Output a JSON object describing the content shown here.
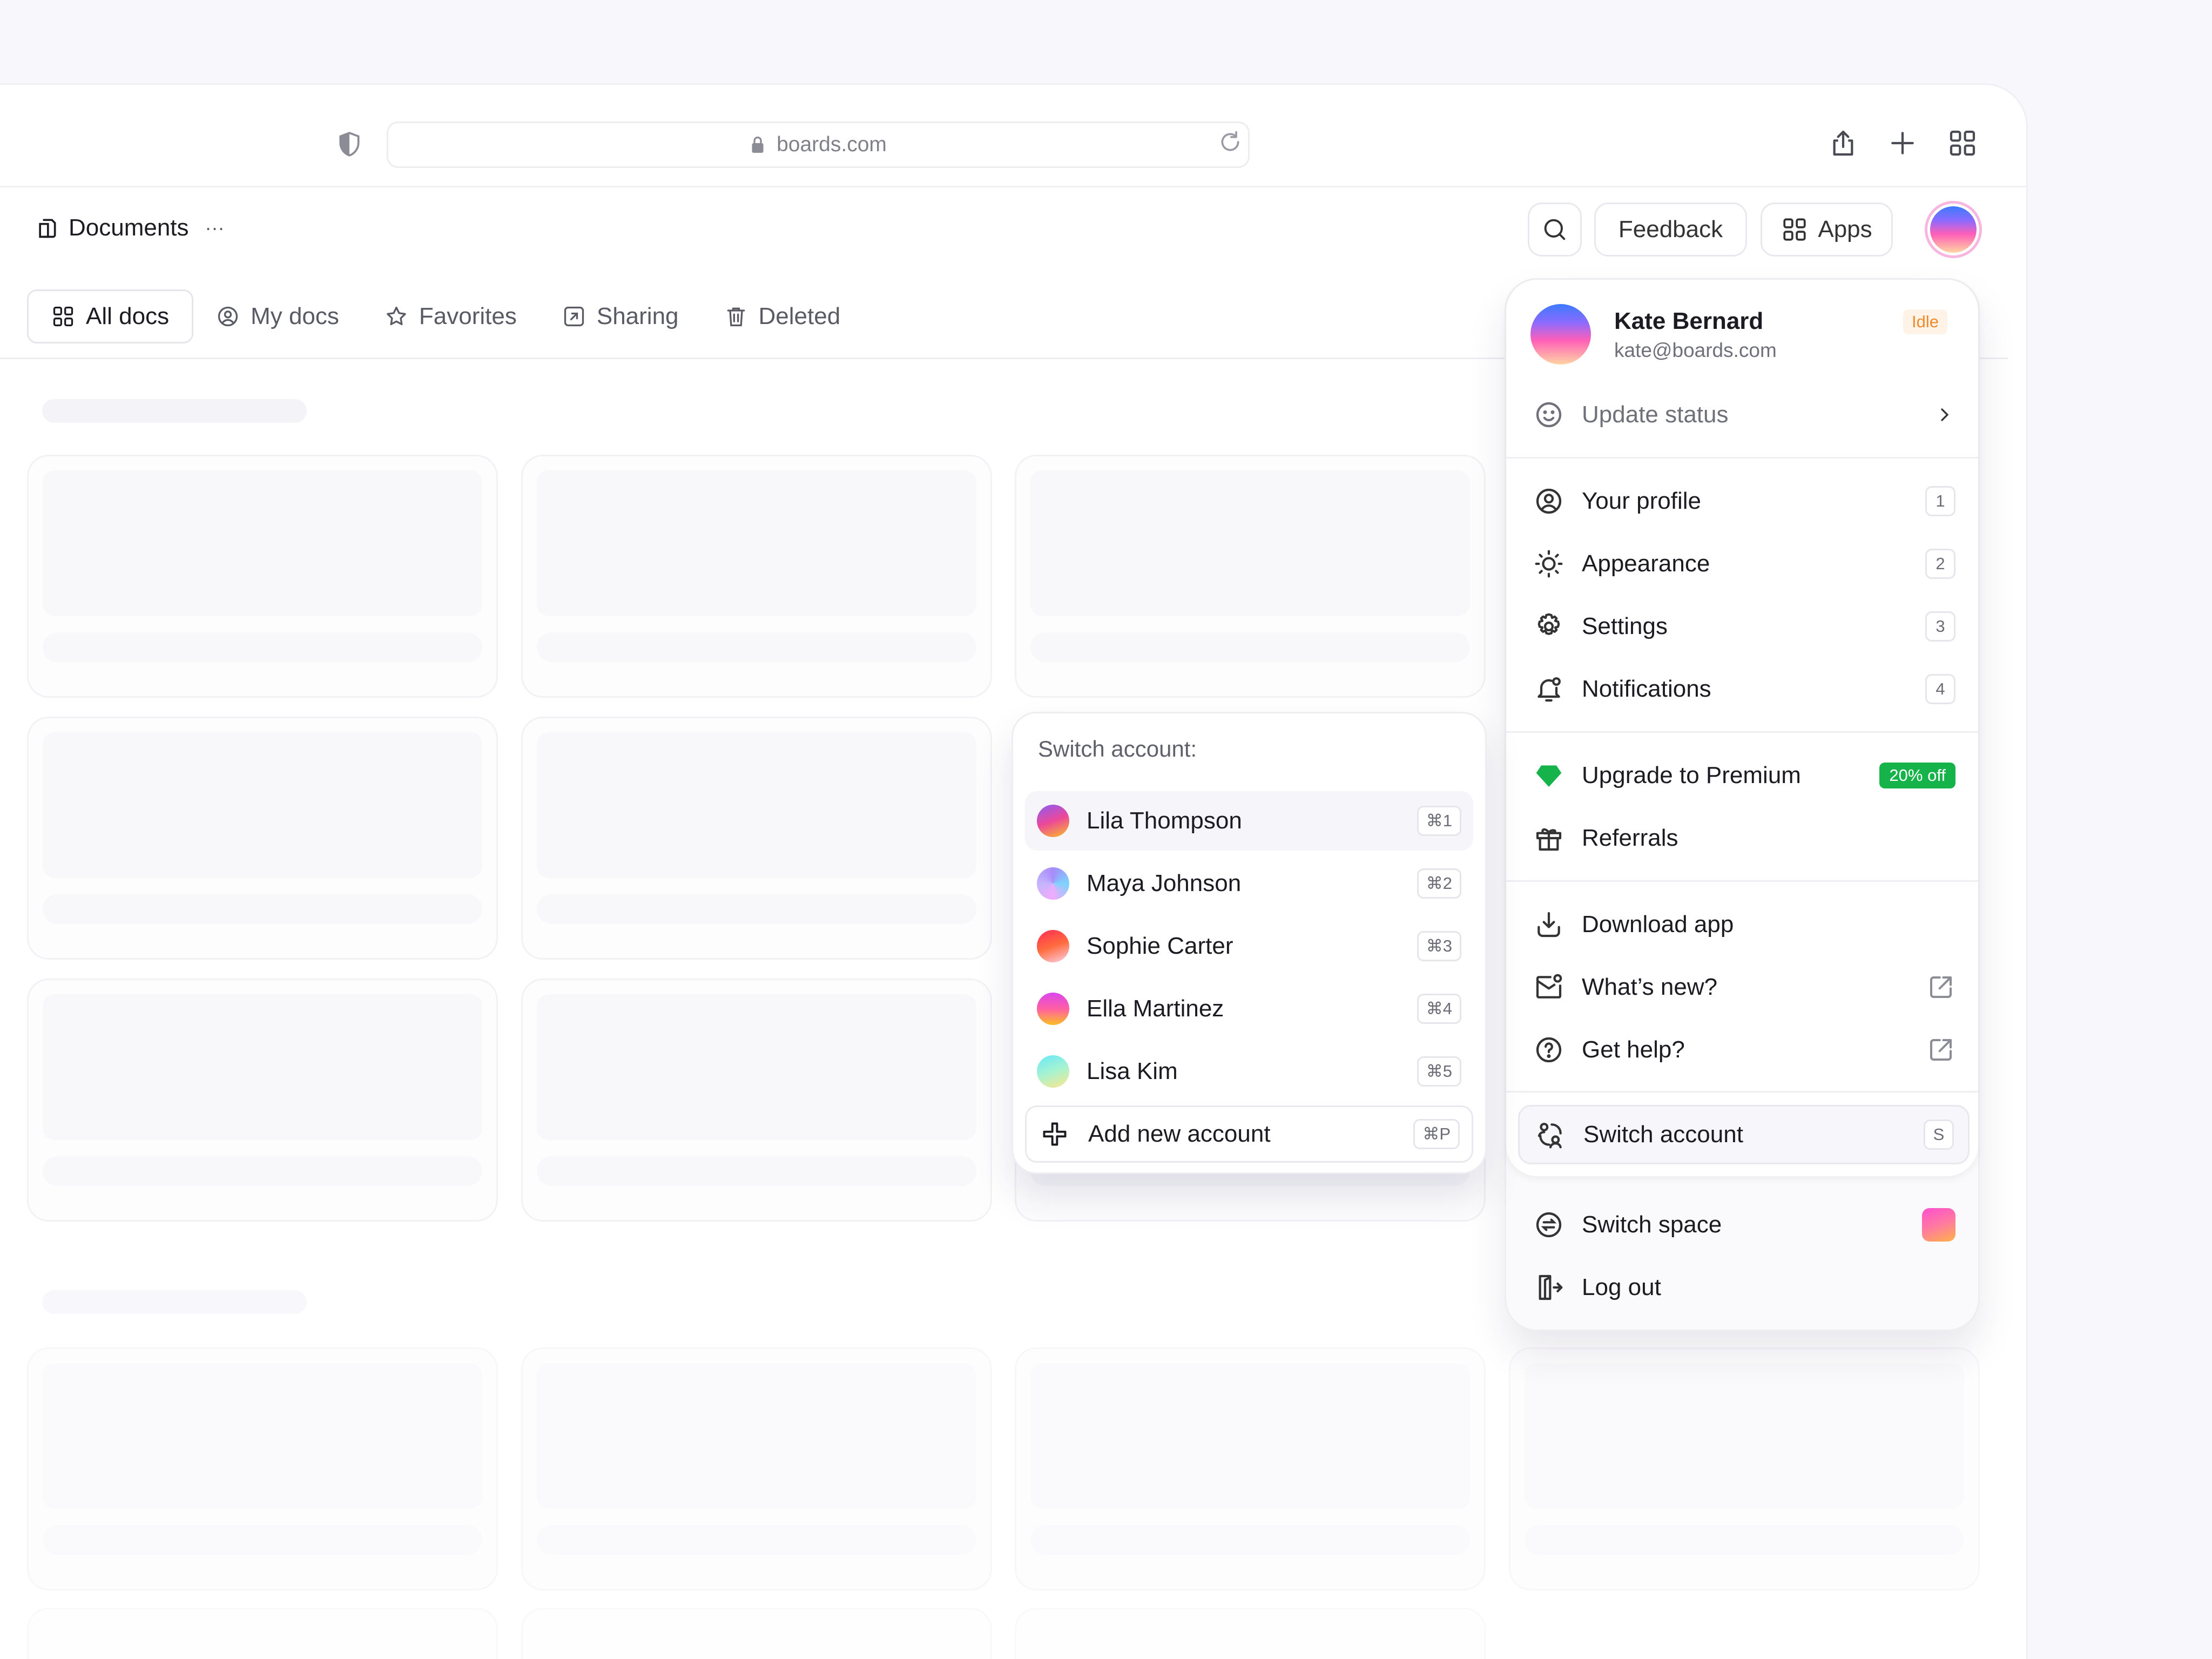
{
  "browser": {
    "url": "boards.com"
  },
  "header": {
    "title": "Documents",
    "more": "···",
    "feedback": "Feedback",
    "apps": "Apps"
  },
  "tabs": [
    {
      "label": "All docs",
      "icon": "grid-icon"
    },
    {
      "label": "My docs",
      "icon": "user-circle-icon"
    },
    {
      "label": "Favorites",
      "icon": "star-icon"
    },
    {
      "label": "Sharing",
      "icon": "share-square-icon"
    },
    {
      "label": "Deleted",
      "icon": "trash-icon"
    }
  ],
  "profile": {
    "name": "Kate Bernard",
    "email": "kate@boards.com",
    "status": "Idle"
  },
  "menu": {
    "update_status": "Update status",
    "items": [
      {
        "label": "Your profile",
        "shortcut": "1",
        "icon": "user-circle-icon"
      },
      {
        "label": "Appearance",
        "shortcut": "2",
        "icon": "sun-icon"
      },
      {
        "label": "Settings",
        "shortcut": "3",
        "icon": "gear-icon"
      },
      {
        "label": "Notifications",
        "shortcut": "4",
        "icon": "bell-icon"
      }
    ],
    "upgrade": "Upgrade to Premium",
    "upgrade_badge": "20% off",
    "referrals": "Referrals",
    "download": "Download app",
    "whats_new": "What’s new?",
    "get_help": "Get help?",
    "switch_account": "Switch account",
    "switch_account_shortcut": "S",
    "switch_space": "Switch space",
    "log_out": "Log out"
  },
  "switch_account": {
    "title": "Switch account:",
    "accounts": [
      {
        "name": "Lila Thompson",
        "shortcut": "⌘1"
      },
      {
        "name": "Maya Johnson",
        "shortcut": "⌘2"
      },
      {
        "name": "Sophie Carter",
        "shortcut": "⌘3"
      },
      {
        "name": "Ella Martinez",
        "shortcut": "⌘4"
      },
      {
        "name": "Lisa Kim",
        "shortcut": "⌘5"
      }
    ],
    "add": "Add new account",
    "add_shortcut": "⌘P"
  },
  "colors": {
    "premium_green": "#16b34a",
    "idle_orange": "#f08a2c",
    "brand_pink": "#f05fb7"
  }
}
